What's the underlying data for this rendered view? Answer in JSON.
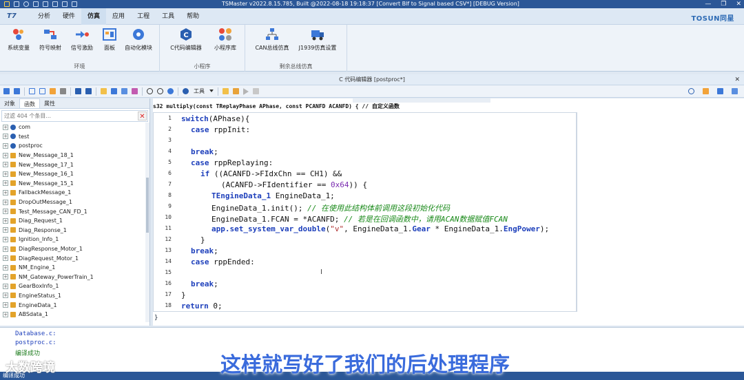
{
  "titlebar": {
    "title": "TSMaster v2022.8.15.785, Built @2022-08-18 19:18:37 [Convert Blf to Signal based CSV*] [DEBUG Version]",
    "controls": [
      "—",
      "❐",
      "✕"
    ]
  },
  "menubar": {
    "logo": "T7",
    "menus": [
      "分析",
      "硬件",
      "仿真",
      "应用",
      "工程",
      "工具",
      "帮助"
    ],
    "active_menu": "仿真",
    "brand": "TOSUN同星"
  },
  "ribbon": {
    "groups": [
      {
        "label": "环境",
        "buttons": [
          "系统变量",
          "符号映射",
          "信号激励",
          "面板",
          "自动化模块"
        ]
      },
      {
        "label": "小程序",
        "buttons": [
          "C代码编辑器",
          "小程序库"
        ]
      },
      {
        "label": "剩余总线仿真",
        "buttons": [
          "CAN总线仿真",
          "J1939仿真设置"
        ]
      }
    ]
  },
  "editor_title": "C 代码编辑器 [postproc*]",
  "toolbar": {
    "tools_label": "工具"
  },
  "left_panel": {
    "tabs": [
      "对象",
      "函数",
      "属性"
    ],
    "active_tab": "函数",
    "filter_placeholder": "过滤 404 个条目...",
    "tree": [
      {
        "label": "com",
        "kind": "cls"
      },
      {
        "label": "test",
        "kind": "cls"
      },
      {
        "label": "postproc",
        "kind": "cls"
      },
      {
        "label": "New_Message_18_1",
        "kind": "msg"
      },
      {
        "label": "New_Message_17_1",
        "kind": "msg"
      },
      {
        "label": "New_Message_16_1",
        "kind": "msg"
      },
      {
        "label": "New_Message_15_1",
        "kind": "msg"
      },
      {
        "label": "FallbackMessage_1",
        "kind": "msg"
      },
      {
        "label": "DropOutMessage_1",
        "kind": "msg"
      },
      {
        "label": "Test_Message_CAN_FD_1",
        "kind": "msg"
      },
      {
        "label": "Diag_Request_1",
        "kind": "msg"
      },
      {
        "label": "Diag_Response_1",
        "kind": "msg"
      },
      {
        "label": "Ignition_Info_1",
        "kind": "msg"
      },
      {
        "label": "DiagResponse_Motor_1",
        "kind": "msg"
      },
      {
        "label": "DiagRequest_Motor_1",
        "kind": "msg"
      },
      {
        "label": "NM_Engine_1",
        "kind": "msg"
      },
      {
        "label": "NM_Gateway_PowerTrain_1",
        "kind": "msg"
      },
      {
        "label": "GearBoxInfo_1",
        "kind": "msg"
      },
      {
        "label": "EngineStatus_1",
        "kind": "msg"
      },
      {
        "label": "EngineData_1",
        "kind": "msg"
      },
      {
        "label": "ABSdata_1",
        "kind": "msg"
      }
    ]
  },
  "editor": {
    "function_signature": "s32 multiply(const TReplayPhase APhase, const PCANFD ACANFD) { // 自定义函数",
    "line_numbers": [
      "1",
      "2",
      "3",
      "4",
      "5",
      "6",
      "7",
      "8",
      "9",
      "10",
      "11",
      "12",
      "13",
      "14",
      "15",
      "16",
      "17",
      "18"
    ],
    "code": {
      "l1_kw": "switch",
      "l1": "(APhase){",
      "l2_kw": "case",
      "l2": " rppInit:",
      "l4_kw": "break",
      "l4": ";",
      "l5_kw": "case",
      "l5": " rppReplaying:",
      "l6_kw": "if",
      "l6a": " ((ACANFD->FIdxChn == CH1) &&",
      "l7a": "(ACANFD->FIdentifier == ",
      "l7_num": "0x64",
      "l7b": ")) {",
      "l8_ty": "TEngineData_1",
      "l8": " EngineData_1;",
      "l9": "EngineData_1.init(); ",
      "l9_cm": "// 在使用此结构体前调用这段初始化代码",
      "l10": "EngineData_1.FCAN = *ACANFD; ",
      "l10_cm": "// 若是在回调函数中，请用ACAN数据赋值FCAN",
      "l11_a": "app.set_system_var_double",
      "l11_b": "(",
      "l11_str": "\"v\"",
      "l11_c": ", EngineData_1.",
      "l11_d": "Gear",
      "l11_e": " * EngineData_1.",
      "l11_f": "EngPower",
      "l11_g": ");",
      "l12": "}",
      "l13_kw": "break",
      "l13": ";",
      "l14_kw": "case",
      "l14": " rppEnded:",
      "l16_kw": "break",
      "l16": ";",
      "l17": "}",
      "l18_kw": "return",
      "l18": " 0;"
    },
    "closing_brace": "}"
  },
  "output": [
    "Database.c:",
    "postproc.c:",
    "编译成功"
  ],
  "statusbar": "编译成功",
  "subtitle": "这样就写好了我们的后处理程序",
  "watermark": "大数跨境"
}
